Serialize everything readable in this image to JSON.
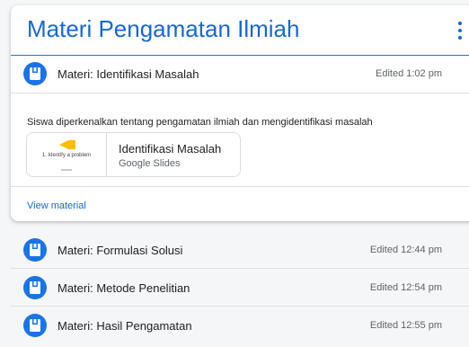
{
  "topic": {
    "title": "Materi Pengamatan Ilmiah",
    "menu_icon": "more-vert-icon"
  },
  "expanded_material": {
    "icon": "material-book-icon",
    "title": "Materi: Identifikasi Masalah",
    "time": "Edited 1:02 pm",
    "description": "Siswa diperkenalkan tentang pengamatan ilmiah dan mengidentifikasi masalah",
    "attachment": {
      "thumbnail_text": "1. Identify a problem",
      "title": "Identifikasi Masalah",
      "type": "Google Slides"
    },
    "view_label": "View material"
  },
  "materials": [
    {
      "title": "Materi: Formulasi Solusi",
      "time": "Edited 12:44 pm",
      "icon": "material-book-icon"
    },
    {
      "title": "Materi: Metode Penelitian",
      "time": "Edited 12:54 pm",
      "icon": "material-book-icon"
    },
    {
      "title": "Materi: Hasil Pengamatan",
      "time": "Edited 12:55 pm",
      "icon": "material-book-icon"
    }
  ],
  "colors": {
    "accent": "#1967d2",
    "icon_bg": "#1a73e8",
    "thumbnail_shape": "#fbbc04"
  }
}
